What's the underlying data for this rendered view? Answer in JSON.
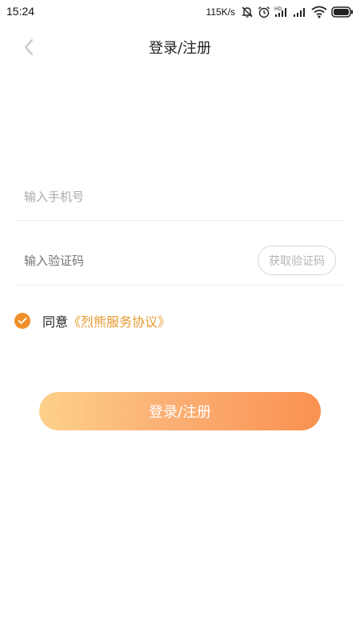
{
  "status_bar": {
    "time": "15:24",
    "network_speed": "115K/s",
    "icons": [
      "mute-icon",
      "alarm-icon",
      "hd-signal-icon",
      "signal-icon",
      "wifi-icon",
      "battery-icon"
    ]
  },
  "nav": {
    "title": "登录/注册",
    "back_icon": "chevron-left-icon"
  },
  "form": {
    "phone_placeholder": "输入手机号",
    "phone_value": "",
    "code_placeholder": "输入验证码",
    "code_value": "",
    "get_code_label": "获取验证码"
  },
  "agreement": {
    "checked": true,
    "prefix": "同意",
    "link": "《烈熊服务协议》"
  },
  "submit_label": "登录/注册",
  "colors": {
    "accent": "#f0902a",
    "button_gradient_start": "#fdd08a",
    "button_gradient_end": "#fa9150",
    "link": "#e89a2e"
  }
}
